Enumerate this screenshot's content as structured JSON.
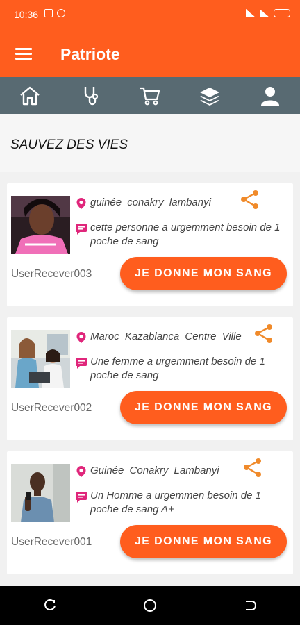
{
  "status_bar": {
    "time": "10:36"
  },
  "app_bar": {
    "title": "Patriote"
  },
  "tabs": [
    {
      "name": "home-icon"
    },
    {
      "name": "stethoscope-icon"
    },
    {
      "name": "cart-icon"
    },
    {
      "name": "layers-icon"
    },
    {
      "name": "user-icon"
    }
  ],
  "section": {
    "title": "SAUVEZ DES VIES"
  },
  "requests": [
    {
      "location": "guinée conakry lambanyi",
      "message": "cette personne a urgemment besoin de 1 poche de sang",
      "user": "UserRecever003",
      "button_label": "JE DONNE MON SANG"
    },
    {
      "location": "Maroc Kazablanca Centre Ville",
      "message": "Une femme a urgemment besoin de 1 poche de sang",
      "user": "UserRecever002",
      "button_label": "JE DONNE MON SANG"
    },
    {
      "location": "Guinée Conakry Lambanyi",
      "message": "Un Homme a urgemmen besoin de 1 poche de sang A+",
      "user": "UserRecever001",
      "button_label": "JE DONNE MON SANG"
    }
  ],
  "colors": {
    "primary": "#ff5d1e",
    "tabbar": "#586a72",
    "accent_pink": "#e0267b",
    "share": "#f08a2a"
  }
}
